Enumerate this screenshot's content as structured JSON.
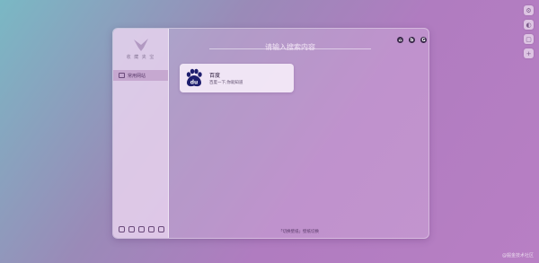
{
  "sidebar": {
    "logo_text": "收 藏 夹 宝",
    "nav_items": [
      {
        "label": "常用网站"
      }
    ]
  },
  "search": {
    "placeholder": "请输入搜索内容"
  },
  "site_cards": [
    {
      "name": "百度",
      "description": "百度一下,你就知道"
    }
  ],
  "footer": {
    "hint": "「切换壁纸」壁纸切换"
  },
  "watermark": "@掘金技术社区"
}
